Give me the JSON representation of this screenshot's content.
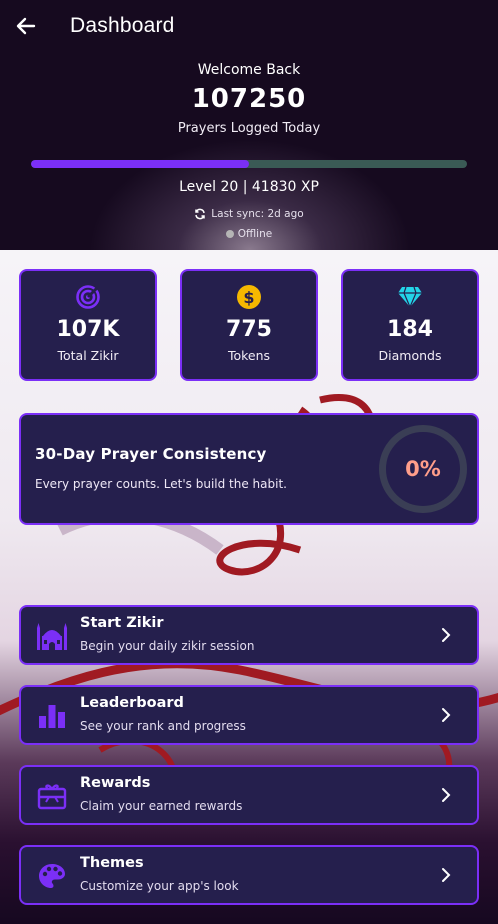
{
  "header": {
    "title": "Dashboard",
    "back_icon": "arrow-left-icon"
  },
  "hero": {
    "welcome": "Welcome Back",
    "count": "107250",
    "count_label": "Prayers Logged Today",
    "xp_progress": 0.5,
    "level_text": "Level 20 | 41830 XP",
    "sync_text": "Last sync: 2d ago",
    "status_text": "Offline"
  },
  "stats": [
    {
      "icon": "target-icon",
      "value": "107K",
      "label": "Total Zikir",
      "color": "#7b2ff7"
    },
    {
      "icon": "dollar-coin-icon",
      "value": "775",
      "label": "Tokens",
      "color": "#f5b800"
    },
    {
      "icon": "diamond-icon",
      "value": "184",
      "label": "Diamonds",
      "color": "#23d4e8"
    }
  ],
  "consistency": {
    "title": "30-Day Prayer Consistency",
    "subtitle": "Every prayer counts. Let's build the habit.",
    "percent": "0%"
  },
  "menu": [
    {
      "icon": "mosque-icon",
      "title": "Start Zikir",
      "subtitle": "Begin your daily zikir session"
    },
    {
      "icon": "bar-chart-icon",
      "title": "Leaderboard",
      "subtitle": "See your rank and progress"
    },
    {
      "icon": "gift-card-icon",
      "title": "Rewards",
      "subtitle": "Claim your earned rewards"
    },
    {
      "icon": "palette-icon",
      "title": "Themes",
      "subtitle": "Customize your app's look"
    }
  ],
  "colors": {
    "accent": "#7b2ff7",
    "card_bg": "#251f4d",
    "progress_track": "#3a5a55",
    "percent_text": "#ff9e8a"
  }
}
